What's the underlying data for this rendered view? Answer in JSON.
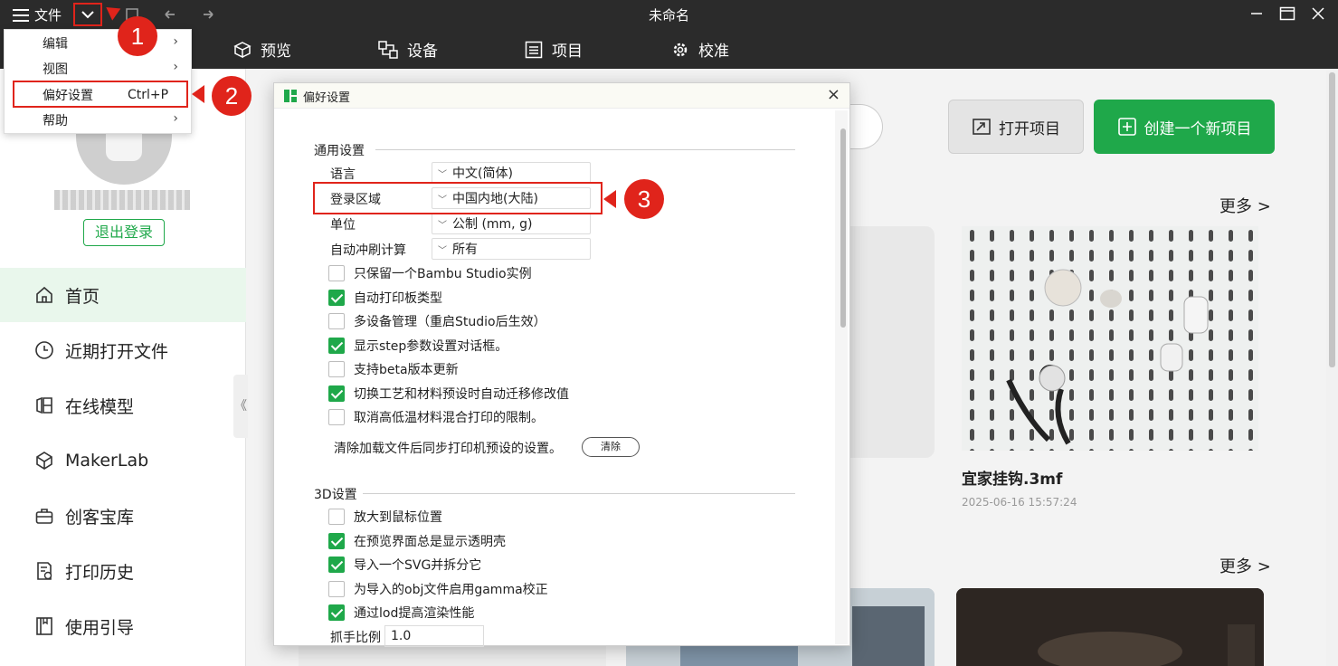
{
  "titlebar": {
    "file_label": "文件",
    "title": "未命名"
  },
  "navbar": {
    "tabs": [
      {
        "label": "预览",
        "icon": "cube-icon"
      },
      {
        "label": "设备",
        "icon": "device-icon"
      },
      {
        "label": "项目",
        "icon": "list-icon"
      },
      {
        "label": "校准",
        "icon": "calibrate-gear-icon"
      }
    ]
  },
  "file_menu": {
    "items": [
      {
        "label": "编辑",
        "has_submenu": true
      },
      {
        "label": "视图",
        "has_submenu": true
      },
      {
        "label": "偏好设置",
        "shortcut": "Ctrl+P"
      },
      {
        "label": "帮助",
        "has_submenu": true
      }
    ]
  },
  "markers": [
    "1",
    "2",
    "3"
  ],
  "sidebar": {
    "logout_label": "退出登录",
    "items": [
      {
        "label": "首页",
        "icon": "home-icon",
        "active": true
      },
      {
        "label": "近期打开文件",
        "icon": "clock-icon"
      },
      {
        "label": "在线模型",
        "icon": "models-icon"
      },
      {
        "label": "MakerLab",
        "icon": "makerlab-icon"
      },
      {
        "label": "创客宝库",
        "icon": "toolbox-icon"
      },
      {
        "label": "打印历史",
        "icon": "history-icon"
      },
      {
        "label": "使用引导",
        "icon": "guide-book-icon"
      }
    ],
    "collapse_glyph": "《"
  },
  "main": {
    "open_project_label": "打开项目",
    "new_project_label": "创建一个新项目",
    "more_label": "更多 >",
    "recent_file": {
      "name": "宜家挂钩.3mf",
      "date": "2025-06-16 15:57:24"
    }
  },
  "dialog": {
    "title": "偏好设置",
    "close_glyph": "×",
    "general_section": "通用设置",
    "fields": [
      {
        "label": "语言",
        "value": "中文(简体)"
      },
      {
        "label": "登录区域",
        "value": "中国内地(大陆)"
      },
      {
        "label": "单位",
        "value": "公制 (mm, g)"
      },
      {
        "label": "自动冲刷计算",
        "value": "所有"
      }
    ],
    "general_checks": [
      {
        "label": "只保留一个Bambu Studio实例",
        "checked": false
      },
      {
        "label": "自动打印板类型",
        "checked": true
      },
      {
        "label": "多设备管理（重启Studio后生效）",
        "checked": false
      },
      {
        "label": "显示step参数设置对话框。",
        "checked": true
      },
      {
        "label": "支持beta版本更新",
        "checked": false
      },
      {
        "label": "切换工艺和材料预设时自动迁移修改值",
        "checked": true
      },
      {
        "label": "取消高低温材料混合打印的限制。",
        "checked": false
      }
    ],
    "clear_text": "清除加载文件后同步打印机预设的设置。",
    "clear_button": "清除",
    "section_3d": "3D设置",
    "checks_3d": [
      {
        "label": "放大到鼠标位置",
        "checked": false
      },
      {
        "label": "在预览界面总是显示透明壳",
        "checked": true
      },
      {
        "label": "导入一个SVG并拆分它",
        "checked": true
      },
      {
        "label": "为导入的obj文件启用gamma校正",
        "checked": false
      },
      {
        "label": "通过lod提高渲染性能",
        "checked": true
      }
    ],
    "grab_label": "抓手比例",
    "grab_value": "1.0"
  },
  "colors": {
    "accent_green": "#1fa84a",
    "marker_red": "#e0241b",
    "dark_bar": "#2b2b2b"
  }
}
